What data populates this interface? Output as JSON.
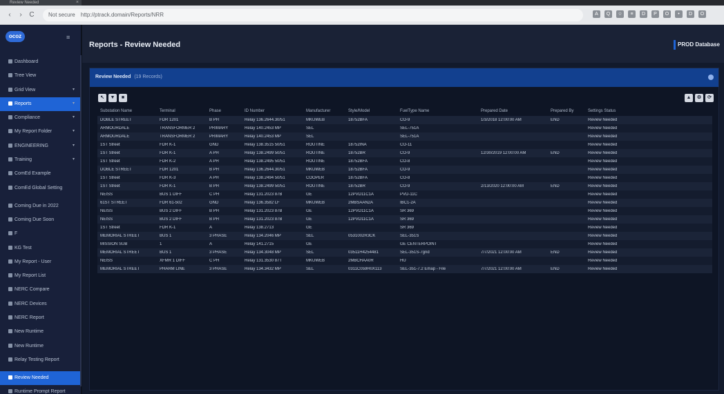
{
  "browser": {
    "tab_title": "Review Needed",
    "tab_close": "×",
    "back": "‹",
    "forward": "›",
    "reload": "C",
    "security": "Not secure",
    "url": "http://ptrack.domain/Reports/NRR",
    "extensions": [
      "A",
      "Q",
      "☆",
      "≡",
      "D",
      "P",
      "O",
      "•",
      "D",
      "O"
    ]
  },
  "sidebar": {
    "logo": "ocoz",
    "menu_icon": "≡",
    "items": [
      {
        "label": "Dashboard",
        "active": false,
        "caret": ""
      },
      {
        "label": "Tree View",
        "active": false,
        "caret": ""
      },
      {
        "label": "Grid View",
        "active": false,
        "caret": "▾"
      },
      {
        "label": "Reports",
        "active": true,
        "caret": "▾"
      },
      {
        "label": "Compliance",
        "active": false,
        "caret": "▾"
      },
      {
        "label": "My Report Folder",
        "active": false,
        "caret": "▾"
      },
      {
        "label": "ENGINEERING",
        "active": false,
        "caret": "▾"
      },
      {
        "label": "Training",
        "active": false,
        "caret": "▾"
      },
      {
        "label": "ComEd Example",
        "active": false,
        "caret": ""
      },
      {
        "label": "ComEd Global Setting",
        "active": false,
        "caret": ""
      },
      {
        "label": "Coming Due in 2022",
        "active": false,
        "caret": ""
      },
      {
        "label": "Coming Due Soon",
        "active": false,
        "caret": ""
      },
      {
        "label": "F",
        "active": false,
        "caret": ""
      },
      {
        "label": "KG Test",
        "active": false,
        "caret": ""
      },
      {
        "label": "My Report - User",
        "active": false,
        "caret": ""
      },
      {
        "label": "My Report List",
        "active": false,
        "caret": ""
      },
      {
        "label": "NERC Compare",
        "active": false,
        "caret": ""
      },
      {
        "label": "NERC Devices",
        "active": false,
        "caret": ""
      },
      {
        "label": "NERC Report",
        "active": false,
        "caret": ""
      },
      {
        "label": "New Runtime",
        "active": false,
        "caret": ""
      },
      {
        "label": "New Runtime",
        "active": false,
        "caret": ""
      },
      {
        "label": "Relay Testing Report",
        "active": false,
        "caret": ""
      },
      {
        "label": "Review Needed",
        "active": true,
        "caret": ""
      },
      {
        "label": "Runtime Prompt Report",
        "active": false,
        "caret": ""
      }
    ]
  },
  "header": {
    "title": "Reports - Review Needed",
    "database": "PROD Database"
  },
  "panel": {
    "title": "Review Needed",
    "record_count": "(19 Records)",
    "toolbar_left": [
      "↖",
      "▼",
      "■"
    ],
    "toolbar_right": [
      "▲",
      "⚙",
      "⟳"
    ]
  },
  "table": {
    "columns": [
      "Substation Name",
      "Terminal",
      "Phase",
      "ID Number",
      "Manufacturer",
      "Style/Model",
      "FuelType Name",
      "Prepared Date",
      "Prepared By",
      "Settings Status"
    ],
    "rows": [
      [
        "DOBLE STREET",
        "FDR 1201",
        "B PH",
        "Relay 136.2644.30/51",
        "MKUWEB",
        "18752BFA",
        "CO-9",
        "1/3/2018 12:00:00 AM",
        "END",
        "Review Needed"
      ],
      [
        "ARMOURDALE",
        "TRANSFORMER 2",
        "PRIMARY",
        "Relay 140.2453 MP",
        "SEL",
        "",
        "SEL-751A",
        "",
        "",
        "Review Needed"
      ],
      [
        "ARMOURDALE",
        "TRANSFORMER 2",
        "PRIMARY",
        "Relay 140.2453 MP",
        "SEL",
        "",
        "SEL-751A",
        "",
        "",
        "Review Needed"
      ],
      [
        "1ST Street",
        "FDR K-1",
        "GND",
        "Relay 138.3515 50/51",
        "ROUTINE",
        "18752INA",
        "CO-11",
        "",
        "",
        "Review Needed"
      ],
      [
        "1ST Street",
        "FDR K-1",
        "A PH",
        "Relay 138.2499 50/51",
        "ROUTINE",
        "18752BR",
        "CO-9",
        "12/30/2019 12:00:00 AM",
        "END",
        "Review Needed"
      ],
      [
        "1ST Street",
        "FDR K-2",
        "A PH",
        "Relay 138.2495 50/51",
        "ROUTINE",
        "18752BFA",
        "CO-8",
        "",
        "",
        "Review Needed"
      ],
      [
        "DOBLE STREET",
        "FDR 1201",
        "B PH",
        "Relay 136.2644.30/51",
        "MKUWEB",
        "18752BFA",
        "CO-9",
        "",
        "",
        "Review Needed"
      ],
      [
        "1ST Street",
        "FDR K-3",
        "A PH",
        "Relay 138.2494 50/51",
        "COOPER",
        "18752BFA",
        "CO-8",
        "",
        "",
        "Review Needed"
      ],
      [
        "1ST Street",
        "FDR K-1",
        "B PH",
        "Relay 138.2499 50/51",
        "ROUTINE",
        "18752BR",
        "CO-9",
        "2/13/2020 12:00:00 AM",
        "END",
        "Review Needed"
      ],
      [
        "NEISS",
        "BUS 1 DIFF",
        "C PH",
        "Relay 131.2023 87B",
        "GE",
        "12PVD11C1A",
        "PVD-11C",
        "",
        "",
        "Review Needed"
      ],
      [
        "61ST STREET",
        "FDR 61-502",
        "GND",
        "Relay 136.3582 LF",
        "MKUWEB",
        "2MBSAAN2A",
        "IBC1-2A",
        "",
        "",
        "Review Needed"
      ],
      [
        "NEISS",
        "BUS 2 DIFF",
        "B PH",
        "Relay 131.2023 87B",
        "GE",
        "12PVD11C1A",
        "SR 369",
        "",
        "",
        "Review Needed"
      ],
      [
        "NEISS",
        "BUS 2 DIFF",
        "B PH",
        "Relay 131.2023 87B",
        "GE",
        "12PVD11C1A",
        "SR 369",
        "",
        "",
        "Review Needed"
      ],
      [
        "1ST Street",
        "FDR K-1",
        "A",
        "Relay 138.2713",
        "GE",
        "",
        "SR 369",
        "",
        "",
        "Review Needed"
      ],
      [
        "MEMORIAL STREET",
        "BUS 1",
        "3 PHASE",
        "Relay 134.2046 MP",
        "SEL",
        "0531002R3CK",
        "SEL-351S",
        "",
        "",
        "Review Needed"
      ],
      [
        "MISSION SUB",
        "1",
        "A",
        "Relay 141.2715",
        "GE",
        "",
        "GE CENTERPOINT",
        "",
        "",
        "Review Needed"
      ],
      [
        "MEMORIAL STREET",
        "BUS 1",
        "3 PHASE",
        "Relay 134.3048 MP",
        "SEL",
        "03511H4254481",
        "SEL-351S-7grid",
        "7/7/2021 12:00:00 AM",
        "END",
        "Review Needed"
      ],
      [
        "NEISS",
        "XFMR 1 DIFF",
        "C PH",
        "Relay 131.3530 87T",
        "MKUWEB",
        "2MBCHAA0R",
        "HU",
        "",
        "",
        "Review Needed"
      ],
      [
        "MEMORIAL STREET",
        "PHARM LINE",
        "3 PHASE",
        "Relay 134.3432 MP",
        "SEL",
        "0311C059H0X113",
        "SEL-351-7.2 Emap - File",
        "7/7/2021 12:00:00 AM",
        "END",
        "Review Needed"
      ]
    ]
  }
}
